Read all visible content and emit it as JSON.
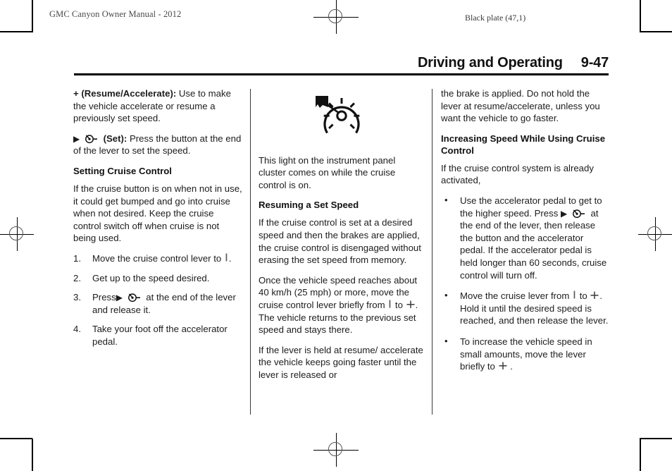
{
  "page": {
    "plate_left": "GMC Canyon Owner Manual - 2012",
    "plate_right": "Black plate (47,1)",
    "chapter_title": "Driving and Operating",
    "page_number": "9-47"
  },
  "symbols": {
    "triangle": "▶",
    "bullet": "•",
    "set_icon_name": "cruise-set-icon",
    "bar_icon_name": "cruise-lever-bar-icon",
    "plus_icon_name": "cruise-lever-plus-icon"
  },
  "left_column": {
    "para_resume_lead": "+ (Resume/Accelerate):",
    "para_resume_text": "Use to make the vehicle accelerate or resume a previously set speed.",
    "para_set_lead": "(Set):",
    "para_set_text": "Press the button at the end of the lever to set the speed.",
    "heading_setting": "Setting Cruise Control",
    "para_warning": "If the cruise button is on when not in use, it could get bumped and go into cruise when not desired. Keep the cruise control switch off when cruise is not being used.",
    "steps": [
      {
        "text_before": "Move the cruise control lever to",
        "text_after": "."
      },
      {
        "text_before": "Get up to the speed desired.",
        "text_after": ""
      },
      {
        "text_before": "Press",
        "text_after": "at the end of the lever and release it."
      },
      {
        "text_before": "Take your foot off the accelerator pedal.",
        "text_after": ""
      }
    ]
  },
  "middle_column": {
    "figure_name": "cruise-control-telltale-illustration",
    "para_telltale": "This light on the instrument panel cluster comes on while the cruise control is on.",
    "heading_resuming": "Resuming a Set Speed",
    "para_brakes": "If the cruise control is set at a desired speed and then the brakes are applied, the cruise control is disengaged without erasing the set speed from memory.",
    "para_resume_a": "Once the vehicle speed reaches about 40 km/h (25 mph) or more, move the cruise control lever briefly from",
    "para_resume_b": "to",
    "para_resume_c": ". The vehicle returns to the previous set speed and stays there.",
    "para_held": "If the lever is held at resume/ accelerate the vehicle keeps going faster until the lever is released or"
  },
  "right_column": {
    "para_brake_cont": "the brake is applied. Do not hold the lever at resume/accelerate, unless you want the vehicle to go faster.",
    "heading_increasing": "Increasing Speed While Using Cruise Control",
    "para_activated": "If the cruise control system is already activated,",
    "bullets": [
      {
        "part_a": "Use the accelerator pedal to get to the higher speed. Press",
        "part_b": "at the end of the lever, then release the button and the accelerator pedal. If the accelerator pedal is held longer than 60 seconds, cruise control will turn off."
      },
      {
        "part_a": "Move the cruise lever from",
        "part_b": "to",
        "part_c": ". Hold it until the desired speed is reached, and then release the lever."
      },
      {
        "part_a": "To increase the vehicle speed in small amounts, move the lever briefly to",
        "part_b": "."
      }
    ]
  }
}
